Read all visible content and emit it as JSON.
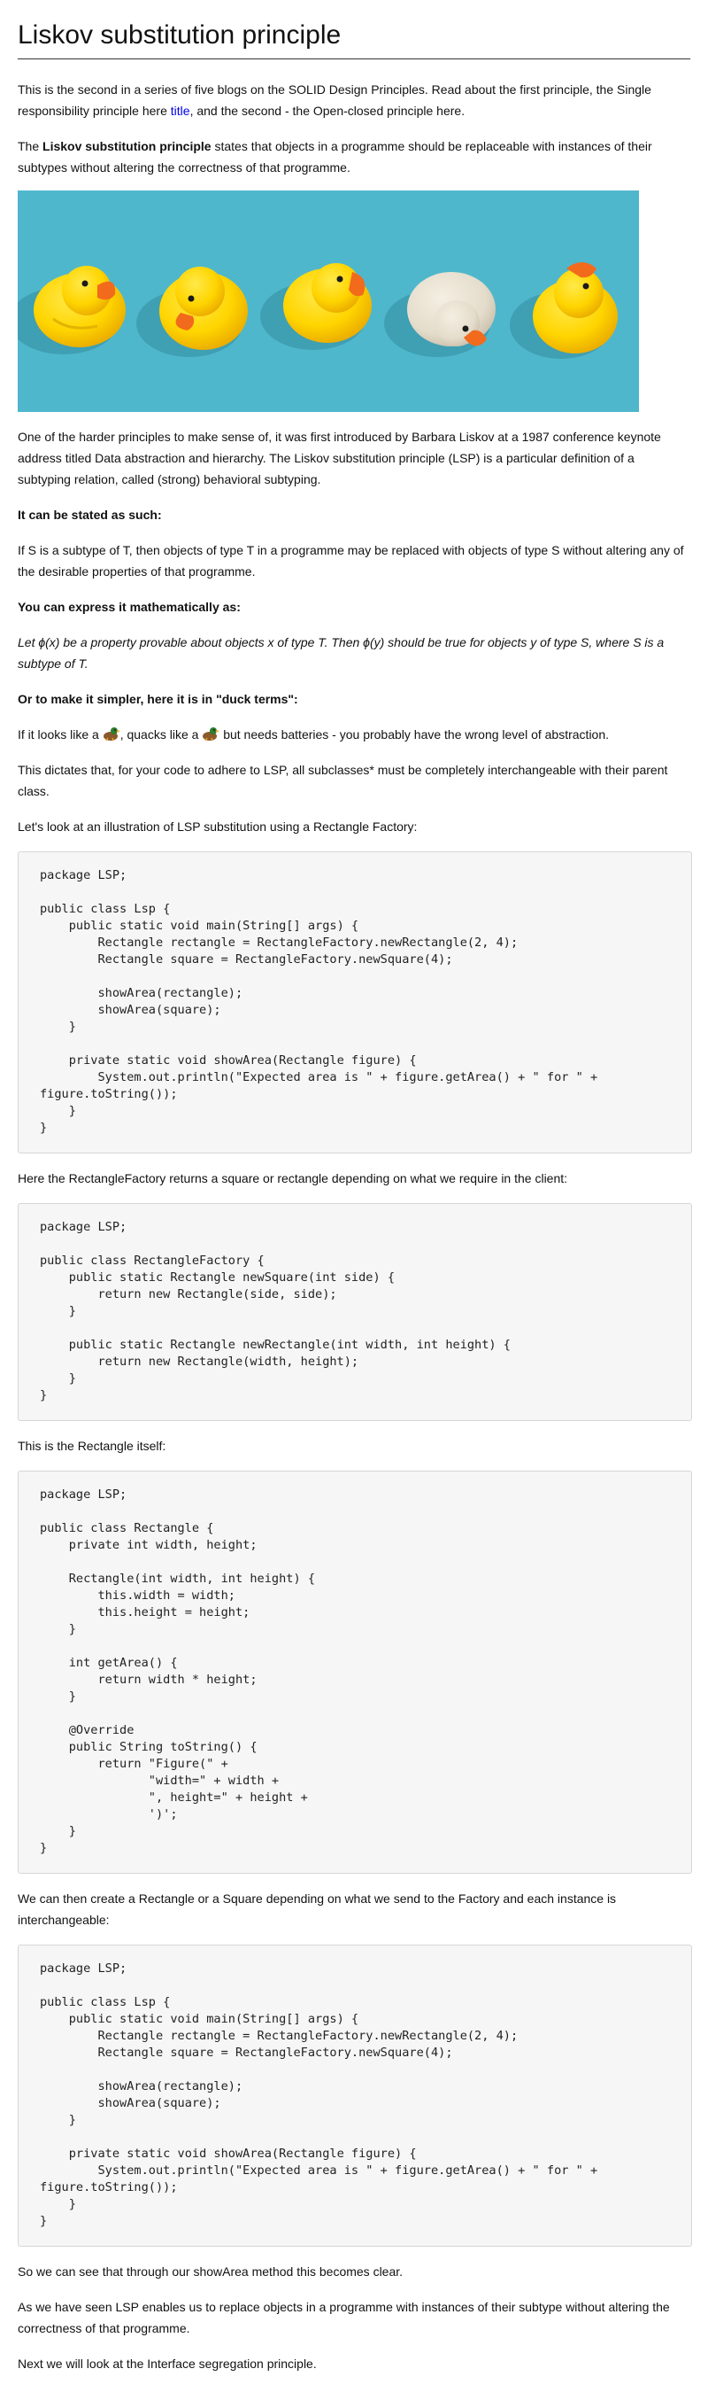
{
  "title": "Liskov substitution principle",
  "intro": {
    "part1": "This is the second in a series of five blogs on the SOLID Design Principles. Read about the first principle, the Single responsibility principle here ",
    "link": "title",
    "part2": ", and the second - the Open-closed principle here."
  },
  "definition": {
    "pre": "The ",
    "bold": "Liskov substitution principle",
    "post": " states that objects in a programme should be replaceable with instances of their subtypes without altering the correctness of that programme."
  },
  "history": "One of the harder principles to make sense of, it was first introduced by Barbara Liskov at a 1987 conference keynote address titled Data abstraction and hierarchy. The Liskov substitution principle (LSP) is a particular definition of a subtyping relation, called (strong) behavioral subtyping.",
  "stated_heading": "It can be stated as such:",
  "stated_text": "If S is a subtype of T, then objects of type T in a programme may be replaced with objects of type S without altering any of the desirable properties of that programme.",
  "math_heading": "You can express it mathematically as:",
  "math_text": "Let ϕ(x) be a property provable about objects x of type T. Then ϕ(y) should be true for objects y of type S, where S is a subtype of T.",
  "duck_heading": "Or to make it simpler, here it is in \"duck terms\":",
  "duck_text": {
    "a": "If it looks like a ",
    "b": ", quacks like a ",
    "c": " but needs batteries - you probably have the wrong level of abstraction."
  },
  "dictates": "This dictates that, for your code to adhere to LSP, all subclasses* must be completely interchangeable with their parent class.",
  "illustration_intro": "Let's look at an illustration of LSP substitution using a Rectangle Factory:",
  "code1": "package LSP;\n\npublic class Lsp {\n    public static void main(String[] args) {\n        Rectangle rectangle = RectangleFactory.newRectangle(2, 4);\n        Rectangle square = RectangleFactory.newSquare(4);\n\n        showArea(rectangle);\n        showArea(square);\n    }\n\n    private static void showArea(Rectangle figure) {\n        System.out.println(\"Expected area is \" + figure.getArea() + \" for \" + figure.toString());\n    }\n}",
  "factory_intro": "Here the RectangleFactory returns a square or rectangle depending on what we require in the client:",
  "code2": "package LSP;\n\npublic class RectangleFactory {\n    public static Rectangle newSquare(int side) {\n        return new Rectangle(side, side);\n    }\n\n    public static Rectangle newRectangle(int width, int height) {\n        return new Rectangle(width, height);\n    }\n}",
  "rectangle_intro": "This is the Rectangle itself:",
  "code3": "package LSP;\n\npublic class Rectangle {\n    private int width, height;\n\n    Rectangle(int width, int height) {\n        this.width = width;\n        this.height = height;\n    }\n\n    int getArea() {\n        return width * height;\n    }\n\n    @Override\n    public String toString() {\n        return \"Figure(\" +\n               \"width=\" + width +\n               \", height=\" + height +\n               ')';\n    }\n}",
  "interchange_intro": "We can then create a Rectangle or a Square depending on what we send to the Factory and each instance is interchangeable:",
  "code4": "package LSP;\n\npublic class Lsp {\n    public static void main(String[] args) {\n        Rectangle rectangle = RectangleFactory.newRectangle(2, 4);\n        Rectangle square = RectangleFactory.newSquare(4);\n\n        showArea(rectangle);\n        showArea(square);\n    }\n\n    private static void showArea(Rectangle figure) {\n        System.out.println(\"Expected area is \" + figure.getArea() + \" for \" + figure.toString());\n    }\n}",
  "show_area": "So we can see that through our showArea method this becomes clear.",
  "summary": "As we have seen LSP enables us to replace objects in a programme with instances of their subtype without altering the correctness of that programme.",
  "next": "Next we will look at the Interface segregation principle.",
  "hero_image": {
    "background": "#4fb7cc",
    "ducks": [
      "yellow",
      "yellow",
      "yellow",
      "white",
      "yellow"
    ]
  },
  "colors": {
    "link": "#0000ee",
    "code_bg": "#f6f6f6",
    "code_border": "#d6d6d6"
  }
}
